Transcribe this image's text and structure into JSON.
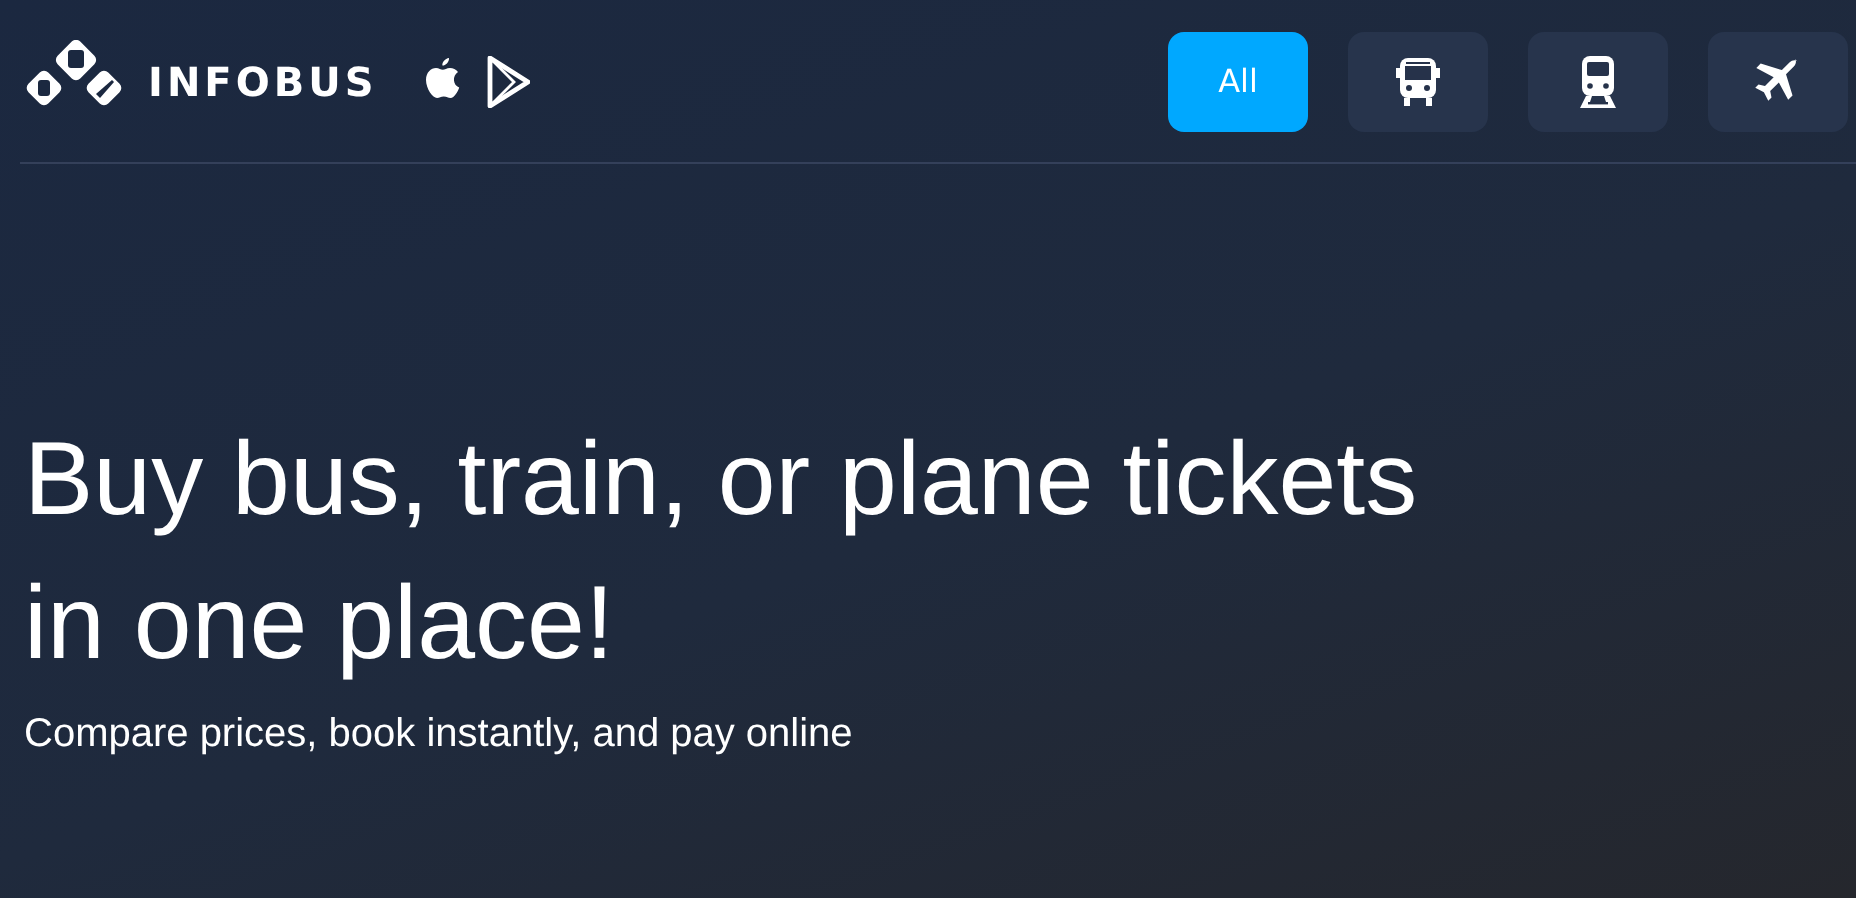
{
  "logo": {
    "text": "INFOBUS"
  },
  "tabs": [
    {
      "kind": "text",
      "label": "All",
      "selected": true
    },
    {
      "kind": "bus",
      "selected": false
    },
    {
      "kind": "train",
      "selected": false
    },
    {
      "kind": "plane",
      "selected": false
    }
  ],
  "hero": {
    "title_lines": [
      "Buy bus, train, or plane tickets",
      "in one place!"
    ],
    "subtitle": "Compare prices, book instantly, and pay online"
  }
}
